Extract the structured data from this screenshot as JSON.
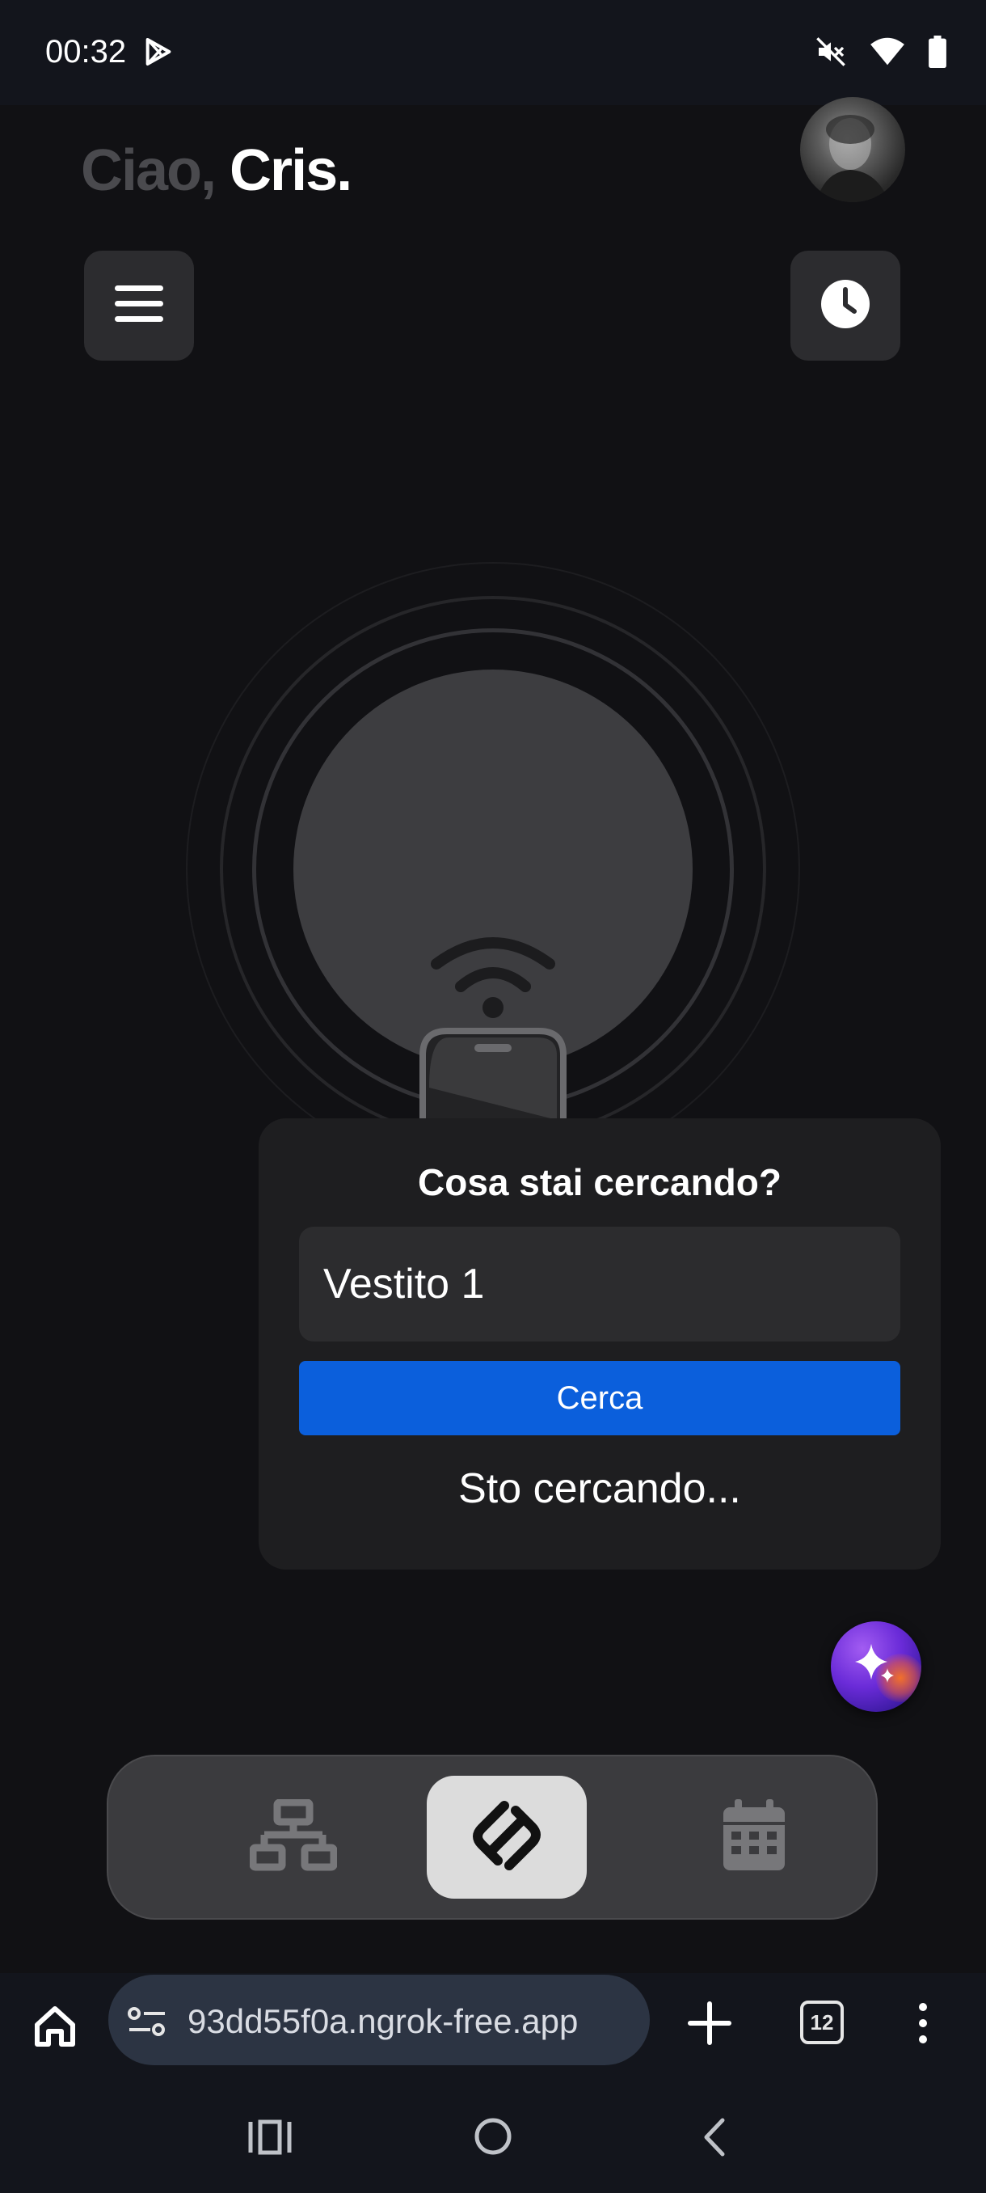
{
  "status_bar": {
    "time": "00:32",
    "icons": [
      "play-store-icon",
      "mute-icon",
      "wifi-icon",
      "battery-icon"
    ]
  },
  "header": {
    "greeting_prefix": "Ciao,",
    "user_name": "Cris."
  },
  "toolbar": {
    "menu_icon": "hamburger-menu-icon",
    "history_icon": "clock-icon"
  },
  "dialog": {
    "title": "Cosa stai cercando?",
    "search_value": "Vestito 1",
    "search_button_label": "Cerca",
    "status_text": "Sto cercando..."
  },
  "bottom_nav": {
    "items": [
      {
        "icon": "network-icon",
        "active": false
      },
      {
        "icon": "nfc-icon",
        "active": true
      },
      {
        "icon": "calendar-icon",
        "active": false
      }
    ]
  },
  "browser": {
    "url": "93dd55f0a.ngrok-free.app",
    "tab_count": "12"
  },
  "colors": {
    "background": "#111114",
    "accent_blue": "#0b5fdc",
    "card": "#1e1e20",
    "nav_active": "#dcdcdc"
  }
}
